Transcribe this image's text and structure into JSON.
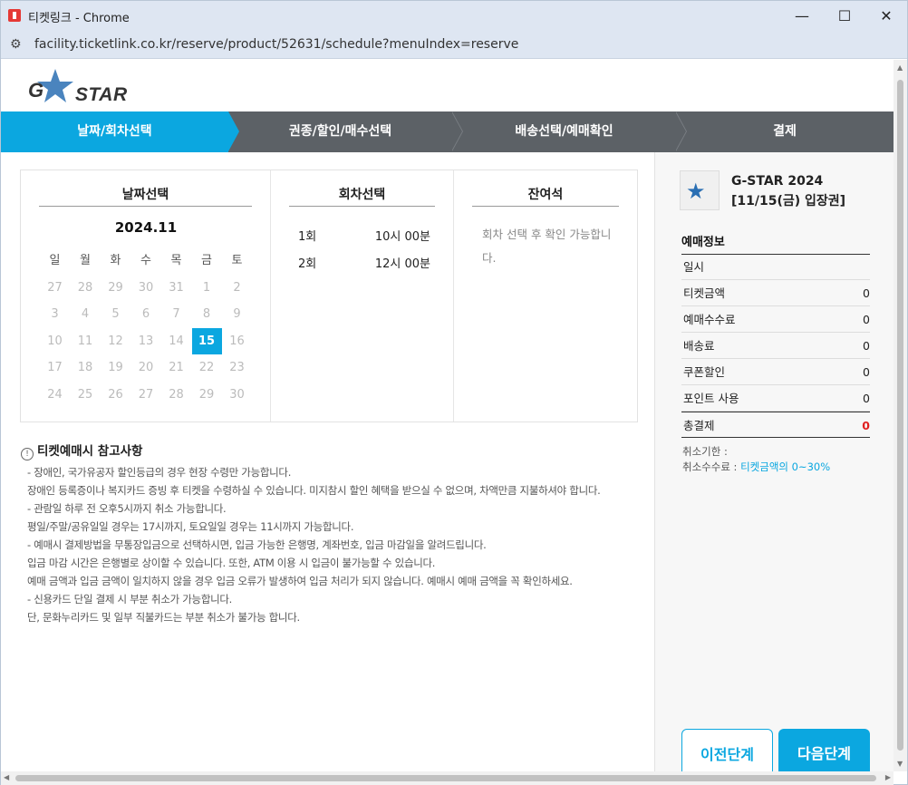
{
  "window": {
    "title": "티켓링크 - Chrome",
    "minimize": "—",
    "maximize": "☐",
    "close": "✕"
  },
  "address_bar": {
    "url": "facility.ticketlink.co.kr/reserve/product/52631/schedule?menuIndex=reserve"
  },
  "brand": {
    "logo_text": "STAR",
    "logo_prefix": "G"
  },
  "steps": [
    {
      "label": "날짜/회차선택",
      "active": true
    },
    {
      "label": "권종/할인/매수선택",
      "active": false
    },
    {
      "label": "배송선택/예매확인",
      "active": false
    },
    {
      "label": "결제",
      "active": false
    }
  ],
  "date_select": {
    "heading": "날짜선택",
    "month": "2024.11",
    "weekdays": [
      "일",
      "월",
      "화",
      "수",
      "목",
      "금",
      "토"
    ],
    "weeks": [
      [
        "27",
        "28",
        "29",
        "30",
        "31",
        "1",
        "2"
      ],
      [
        "3",
        "4",
        "5",
        "6",
        "7",
        "8",
        "9"
      ],
      [
        "10",
        "11",
        "12",
        "13",
        "14",
        "15",
        "16"
      ],
      [
        "17",
        "18",
        "19",
        "20",
        "21",
        "22",
        "23"
      ],
      [
        "24",
        "25",
        "26",
        "27",
        "28",
        "29",
        "30"
      ]
    ],
    "selected_day": "15"
  },
  "session_select": {
    "heading": "회차선택",
    "sessions": [
      {
        "round": "1회",
        "time": "10시 00분"
      },
      {
        "round": "2회",
        "time": "12시 00분"
      }
    ]
  },
  "remaining": {
    "heading": "잔여석",
    "message": "회차 선택 후 확인 가능합니다."
  },
  "notes": {
    "title": "티켓예매시 참고사항",
    "lines": [
      "- 장애인, 국가유공자 할인등급의 경우 현장 수령만 가능합니다.",
      "장애인 등록증이나 복지카드 증빙 후 티켓을 수령하실 수 있습니다. 미지참시 할인 혜택을 받으실 수 없으며, 차액만큼 지불하셔야 합니다.",
      "- 관람일 하루 전 오후5시까지 취소 가능합니다.",
      "평일/주말/공유일일 경우는 17시까지, 토요일일 경우는 11시까지 가능합니다.",
      "- 예매시 결제방법을 무통장입금으로 선택하시면, 입금 가능한 은행명, 계좌번호, 입금 마감일을 알려드립니다.",
      "입금 마감 시간은 은행별로 상이할 수 있습니다. 또한, ATM 이용 시 입금이 불가능할 수 있습니다.",
      "예매 금액과 입금 금액이 일치하지 않을 경우 입금 오류가 발생하여 입금 처리가 되지 않습니다. 예매시 예매 금액을 꼭 확인하세요.",
      "- 신용카드 단일 결제 시 부분 취소가 가능합니다.",
      "단, 문화누리카드 및 일부 직불카드는 부분 취소가 불가능 합니다."
    ]
  },
  "summary": {
    "product_title": "G-STAR 2024 [11/15(금) 입장권]",
    "heading": "예매정보",
    "rows": [
      {
        "label": "일시",
        "value": ""
      },
      {
        "label": "티켓금액",
        "value": "0"
      },
      {
        "label": "예매수수료",
        "value": "0"
      },
      {
        "label": "배송료",
        "value": "0"
      },
      {
        "label": "쿠폰할인",
        "value": "0"
      },
      {
        "label": "포인트 사용",
        "value": "0"
      }
    ],
    "total": {
      "label": "총결제",
      "value": "0"
    },
    "cancel_deadline_label": "취소기한 :",
    "cancel_fee_label": "취소수수료 :",
    "cancel_fee_value": "티켓금액의 0~30%"
  },
  "buttons": {
    "prev": "이전단계",
    "next": "다음단계"
  },
  "colors": {
    "accent": "#0ba7e0",
    "step_bar": "#5c6166",
    "total_value": "#e02020"
  }
}
